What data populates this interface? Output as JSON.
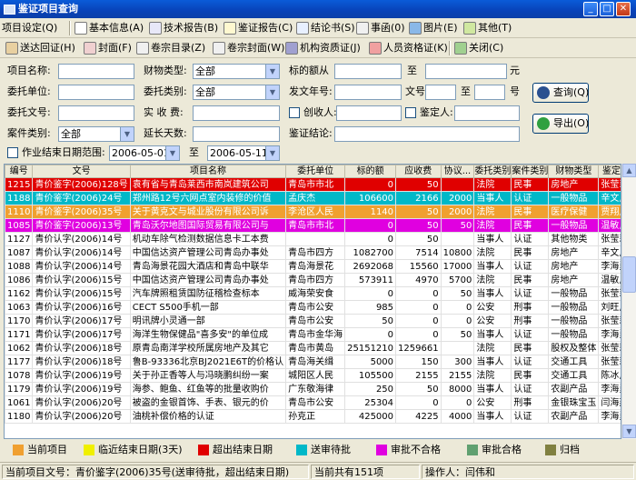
{
  "window": {
    "title": "鉴证项目查询",
    "minimize": "_",
    "maximize": "□",
    "close": "✕"
  },
  "toolbar1": [
    {
      "label": "项目设定(Q)",
      "icon": "project-settings-icon",
      "color": "#ffffff"
    },
    {
      "label": "基本信息(A)",
      "icon": "basic-info-icon",
      "color": "#f4f4f4"
    },
    {
      "label": "技术报告(B)",
      "icon": "tech-report-icon",
      "color": "#e8e8f8"
    },
    {
      "label": "鉴证报告(C)",
      "icon": "appraisal-report-icon",
      "color": "#fff8d0"
    },
    {
      "label": "结论书(S)",
      "icon": "conclusion-icon",
      "color": "#e8f0ff"
    },
    {
      "label": "事函(0)",
      "icon": "letter-icon",
      "color": "#f0f0f0"
    },
    {
      "label": "图片(E)",
      "icon": "picture-icon",
      "color": "#8ab8e8"
    },
    {
      "label": "其他(T)",
      "icon": "other-icon",
      "color": "#d0e8a0"
    }
  ],
  "toolbar2": [
    {
      "label": "送达回证(H)",
      "icon": "receipt-icon",
      "color": "#e8d0a0"
    },
    {
      "label": "封面(F)",
      "icon": "cover-icon",
      "color": "#f0d0d0"
    },
    {
      "label": "卷宗目录(Z)",
      "icon": "file-index-icon",
      "color": "#f0f0f0"
    },
    {
      "label": "卷宗封面(W)",
      "icon": "file-cover-icon",
      "color": "#f0f0f0"
    },
    {
      "label": "机构资质证(J)",
      "icon": "agency-cert-icon",
      "color": "#a0a0d0"
    },
    {
      "label": "人员资格证(K)",
      "icon": "staff-cert-icon",
      "color": "#f0a0a0"
    },
    {
      "label": "关闭(C)",
      "icon": "close-doc-icon",
      "color": "#a0d090"
    }
  ],
  "form": {
    "project_name_label": "项目名称:",
    "project_name_value": "",
    "property_type_label": "财物类型:",
    "property_type_value": "全部",
    "amount_label": "标的额从",
    "amount_from": "",
    "amount_to_label": "至",
    "amount_to": "",
    "amount_unit": "元",
    "client_unit_label": "委托单位:",
    "client_unit_value": "",
    "client_type_label": "委托类别:",
    "client_type_value": "全部",
    "doc_year_label": "发文年号:",
    "doc_year_value": "",
    "doc_no_label": "文号",
    "doc_no_from": "",
    "doc_no_to_label": "至",
    "doc_no_to": "",
    "doc_no_unit": "号",
    "client_doc_label": "委托文号:",
    "client_doc_value": "",
    "received_label": "实 收 费:",
    "received_value": "",
    "payee_label": "创收人:",
    "payee_value": "",
    "appraiser_label": "鉴定人:",
    "appraiser_value": "",
    "case_type_label": "案件类别:",
    "case_type_value": "全部",
    "extend_days_label": "延长天数:",
    "extend_days_value": "",
    "conclusion_label": "鉴证结论:",
    "conclusion_value": "",
    "deadline_label": "作业结束日期范围:",
    "date_from": "2006-05-01",
    "date_to_label": "至",
    "date_to": "2006-05-11",
    "query_button": "查询(Q)",
    "export_button": "导出(O)"
  },
  "table": {
    "columns": [
      "编号",
      "文号",
      "项目名称",
      "委托单位",
      "标的额",
      "应收费",
      "协议...",
      "委托类别",
      "案件类别",
      "财物类型",
      "鉴定人"
    ],
    "rows": [
      {
        "bg": "#e00000",
        "fg": "#ffffff",
        "cells": [
          "1215",
          "青价鉴字(2006)128号",
          "袁有省与青岛莱西市南岚建筑公司",
          "青岛市市北",
          "0",
          "50",
          "",
          "法院",
          "民事",
          "房地产",
          "张莹莉"
        ]
      },
      {
        "bg": "#00b8c8",
        "fg": "#ffffff",
        "cells": [
          "1188",
          "青价鉴字(2006)24号",
          "郑州路12号六网点室内装修的价值",
          "孟庆杰",
          "106600",
          "2166",
          "2000",
          "当事人",
          "认证",
          "一般物品",
          "辛文,黄"
        ]
      },
      {
        "bg": "#f0a030",
        "fg": "#ffffff",
        "cells": [
          "1110",
          "青价鉴字(2006)35号",
          "关于黄克文与城业股份有限公司诉",
          "李沧区人民",
          "1140",
          "50",
          "2000",
          "法院",
          "民事",
          "医疗保健",
          "贾翔,刘"
        ]
      },
      {
        "bg": "#e000e0",
        "fg": "#ffffff",
        "cells": [
          "1085",
          "青价鉴字(2006)13号",
          "青岛沃尔地图国际贸易有限公司与",
          "青岛市市北",
          "0",
          "50",
          "50",
          "法院",
          "民事",
          "一般物品",
          "温敏,辛"
        ]
      },
      {
        "bg": "#ffffff",
        "fg": "#000000",
        "cells": [
          "1127",
          "青价认字(2006)14号",
          "机动车除气检测数据信息卡工本费",
          "",
          "0",
          "50",
          "",
          "当事人",
          "认证",
          "其他物类",
          "张莹莉"
        ]
      },
      {
        "bg": "#ffffff",
        "fg": "#000000",
        "cells": [
          "1087",
          "青价认字(2006)14号",
          "中国信达资产管理公司青岛办事处",
          "青岛市四方",
          "1082700",
          "7514",
          "10800",
          "法院",
          "民事",
          "房地产",
          "辛文,谢"
        ]
      },
      {
        "bg": "#ffffff",
        "fg": "#000000",
        "cells": [
          "1088",
          "青价认字(2006)14号",
          "青岛海景花园大酒店和青岛中联华",
          "青岛海景花",
          "2692068",
          "15560",
          "17000",
          "当事人",
          "认证",
          "房地产",
          "李海勇"
        ]
      },
      {
        "bg": "#ffffff",
        "fg": "#000000",
        "cells": [
          "1086",
          "青价认字(2006)15号",
          "中国信达资产管理公司青岛办事处",
          "青岛市四方",
          "573911",
          "4970",
          "5700",
          "法院",
          "民事",
          "房地产",
          "温敏,辛"
        ]
      },
      {
        "bg": "#ffffff",
        "fg": "#000000",
        "cells": [
          "1162",
          "青价认字(2006)15号",
          "汽车牌照租赁国防征稽检查标本",
          "威海荣安食",
          "0",
          "0",
          "50",
          "当事人",
          "认证",
          "一般物品",
          "张莹莉"
        ]
      },
      {
        "bg": "#ffffff",
        "fg": "#000000",
        "cells": [
          "1063",
          "青价认字(2006)16号",
          "CECT S500手机一部",
          "青岛市公安",
          "985",
          "0",
          "0",
          "公安",
          "刑事",
          "一般物品",
          "刘旺,张"
        ]
      },
      {
        "bg": "#ffffff",
        "fg": "#000000",
        "cells": [
          "1170",
          "青价认字(2006)17号",
          "明讯牌小灵通一部",
          "青岛市公安",
          "50",
          "0",
          "0",
          "公安",
          "刑事",
          "一般物品",
          "张莹莉"
        ]
      },
      {
        "bg": "#ffffff",
        "fg": "#000000",
        "cells": [
          "1171",
          "青价认字(2006)17号",
          "海洋生物保健品\"喜多安\"的单位成",
          "青岛市金华海",
          "0",
          "0",
          "50",
          "当事人",
          "认证",
          "一般物品",
          "李海勇"
        ]
      },
      {
        "bg": "#ffffff",
        "fg": "#000000",
        "cells": [
          "1062",
          "青价认字(2006)18号",
          "原青岛南洋学校所属房地产及其它",
          "青岛市黄岛",
          "25151210",
          "1259661",
          "",
          "法院",
          "民事",
          "股权及整体",
          "张莹莉"
        ]
      },
      {
        "bg": "#ffffff",
        "fg": "#000000",
        "cells": [
          "1177",
          "青价认字(2006)18号",
          "鲁B-93336北京BJ2021E6T的价格认",
          "青岛海关缉",
          "5000",
          "150",
          "300",
          "当事人",
          "认证",
          "交通工具",
          "张莹莉"
        ]
      },
      {
        "bg": "#ffffff",
        "fg": "#000000",
        "cells": [
          "1078",
          "青价认字(2006)19号",
          "关于孙正香等人与冯晓鹏纠纷一案",
          "城阳区人民",
          "105500",
          "2155",
          "2155",
          "法院",
          "民事",
          "交通工具",
          "陈冰,王"
        ]
      },
      {
        "bg": "#ffffff",
        "fg": "#000000",
        "cells": [
          "1179",
          "青价认字(2006)19号",
          "海参、鲍鱼、红鱼等的批量收购价",
          "广东敬海律",
          "250",
          "50",
          "8000",
          "当事人",
          "认证",
          "农副产品",
          "李海勇"
        ]
      },
      {
        "bg": "#ffffff",
        "fg": "#000000",
        "cells": [
          "1061",
          "青价认字(2006)20号",
          "被盗的金银首饰、手表、银元的价",
          "青岛市公安",
          "25304",
          "0",
          "0",
          "公安",
          "刑事",
          "金银珠宝玉",
          "闫海燕"
        ]
      },
      {
        "bg": "#ffffff",
        "fg": "#000000",
        "cells": [
          "1180",
          "青价认字(2006)20号",
          "油桃补偿价格的认证",
          "孙克正",
          "425000",
          "4225",
          "4000",
          "当事人",
          "认证",
          "农副产品",
          "李海勇"
        ]
      }
    ]
  },
  "legend": [
    {
      "label": "当前项目",
      "color": "#f0a030"
    },
    {
      "label": "临近结束日期(3天)",
      "color": "#f0f000"
    },
    {
      "label": "超出结束日期",
      "color": "#e00000"
    },
    {
      "label": "送审待批",
      "color": "#00b8c8"
    },
    {
      "label": "审批不合格",
      "color": "#e000e0"
    },
    {
      "label": "审批合格",
      "color": "#60a070"
    },
    {
      "label": "归档",
      "color": "#808040"
    }
  ],
  "status": {
    "current": "当前项目文号：青价鉴字(2006)35号(送审待批，超出结束日期)",
    "total": "当前共有151项",
    "operator": "操作人：闫伟和"
  }
}
